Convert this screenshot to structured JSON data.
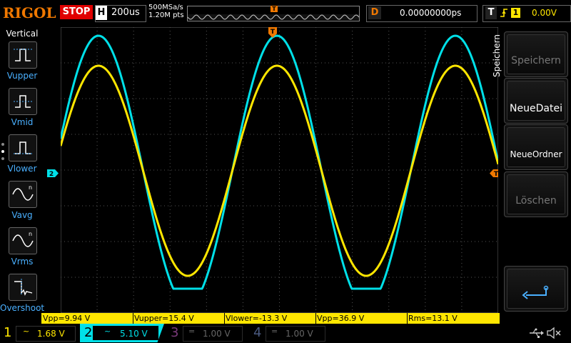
{
  "topbar": {
    "brand": "RIGOL",
    "run_state": "STOP",
    "horizontal_label": "H",
    "timebase": "200us",
    "sample_rate": "500MSa/s",
    "memory_depth": "1.20M pts",
    "trigger_marker": "T",
    "delay_label": "D",
    "delay_value": "0.00000000ps",
    "trigger_label": "T",
    "trigger_slope": "rising-edge-icon",
    "trigger_channel": "1",
    "trigger_level": "0.00V"
  },
  "left_menu": {
    "title": "Vertical",
    "items": [
      {
        "label": "Vupper",
        "icon": "vupper-icon"
      },
      {
        "label": "Vmid",
        "icon": "vmid-icon"
      },
      {
        "label": "Vlower",
        "icon": "vlower-icon"
      },
      {
        "label": "Vavg",
        "icon": "vavg-icon"
      },
      {
        "label": "Vrms",
        "icon": "vrms-icon"
      },
      {
        "label": "Overshoot",
        "icon": "overshoot-icon"
      }
    ]
  },
  "grid": {
    "trigger_pos_marker": "T",
    "ch2_marker": "2",
    "trigger_level_marker": "T"
  },
  "right_menu": {
    "title": "Speichern",
    "buttons": [
      {
        "label": "Speichern",
        "enabled": false
      },
      {
        "label": "NeueDatei",
        "enabled": true
      },
      {
        "label": "NeueOrdner",
        "enabled": true
      },
      {
        "label": "Löschen",
        "enabled": false
      },
      {
        "label": "",
        "icon": "return-arrow-icon",
        "enabled": true
      }
    ]
  },
  "measurements": [
    "Vpp=9.94 V",
    "Vupper=15.4 V",
    "Vlower=-13.3 V",
    "Vpp=36.9 V",
    "Rms=13.1 V"
  ],
  "channels": [
    {
      "num": "1",
      "coupling": "~",
      "scale": "1.68 V",
      "color": "#ffe600",
      "active": true
    },
    {
      "num": "2",
      "coupling": "~",
      "scale": "5.10 V",
      "color": "#00e0e8",
      "active": true
    },
    {
      "num": "3",
      "coupling": "=",
      "scale": "1.00 V",
      "color": "#7a3a7a",
      "active": false
    },
    {
      "num": "4",
      "coupling": "=",
      "scale": "1.00 V",
      "color": "#4a5a80",
      "active": false
    }
  ],
  "status_icons": [
    "usb-icon",
    "mute-speaker-icon"
  ],
  "colors": {
    "ch1": "#ffe600",
    "ch2": "#00e0e8",
    "accent": "#f07800",
    "stop": "#e00000"
  }
}
